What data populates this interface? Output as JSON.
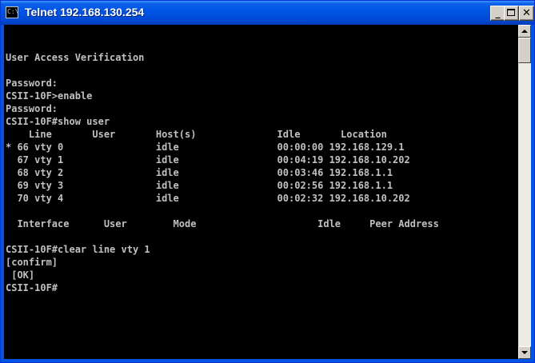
{
  "window": {
    "title": "Telnet 192.168.130.254",
    "icon": "console-icon",
    "icon_text": "C:\\",
    "controls": {
      "minimize": "_",
      "close": "✕"
    }
  },
  "terminal": {
    "lines": [
      "",
      "",
      "User Access Verification",
      "",
      "Password:",
      "CSII-10F>enable",
      "Password:",
      "CSII-10F#show user",
      "    Line       User       Host(s)              Idle       Location",
      "* 66 vty 0                idle                 00:00:00 192.168.129.1",
      "  67 vty 1                idle                 00:04:19 192.168.10.202",
      "  68 vty 2                idle                 00:03:46 192.168.1.1",
      "  69 vty 3                idle                 00:02:56 192.168.1.1",
      "  70 vty 4                idle                 00:02:32 192.168.10.202",
      "",
      "  Interface      User        Mode                     Idle     Peer Address",
      "",
      "CSII-10F#clear line vty 1",
      "[confirm]",
      " [OK]",
      "CSII-10F#"
    ]
  },
  "colors": {
    "titlebar": "#0054e3",
    "terminal_bg": "#000000",
    "terminal_fg": "#c0c0c0"
  }
}
